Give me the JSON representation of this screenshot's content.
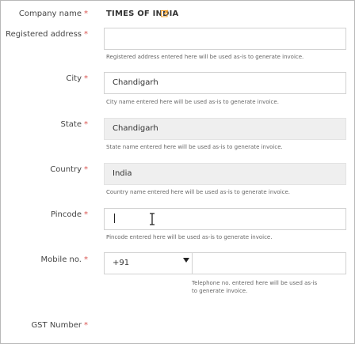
{
  "company": {
    "label": "Company name",
    "value": "TIMES OF INDIA"
  },
  "required_marker": "*",
  "registered_address": {
    "label": "Registered address",
    "value": "",
    "hint": "Registered address entered here will be used as-is to generate invoice."
  },
  "city": {
    "label": "City",
    "value": "Chandigarh",
    "hint": "City name entered here will be used as-is to generate invoice."
  },
  "state": {
    "label": "State",
    "value": "Chandigarh",
    "hint": "State name entered here will be used as-is to generate invoice."
  },
  "country": {
    "label": "Country",
    "value": "India",
    "hint": "Country name entered here will be used as-is to generate invoice."
  },
  "pincode": {
    "label": "Pincode",
    "value": "",
    "hint": "Pincode entered here will be used as-is to generate invoice."
  },
  "mobile": {
    "label": "Mobile no.",
    "country_code": "+91",
    "value": "",
    "hint_line1": "Telephone no. entered here will be used as-is",
    "hint_line2": "to generate invoice."
  },
  "gst": {
    "label": "GST Number"
  },
  "icons": {
    "edit": "edit-icon",
    "dropdown": "chevron-down-icon",
    "cursor": "text-cursor-icon"
  },
  "colors": {
    "required": "#d9534f",
    "edit_icon": "#f0a030",
    "readonly_bg": "#efefef"
  }
}
